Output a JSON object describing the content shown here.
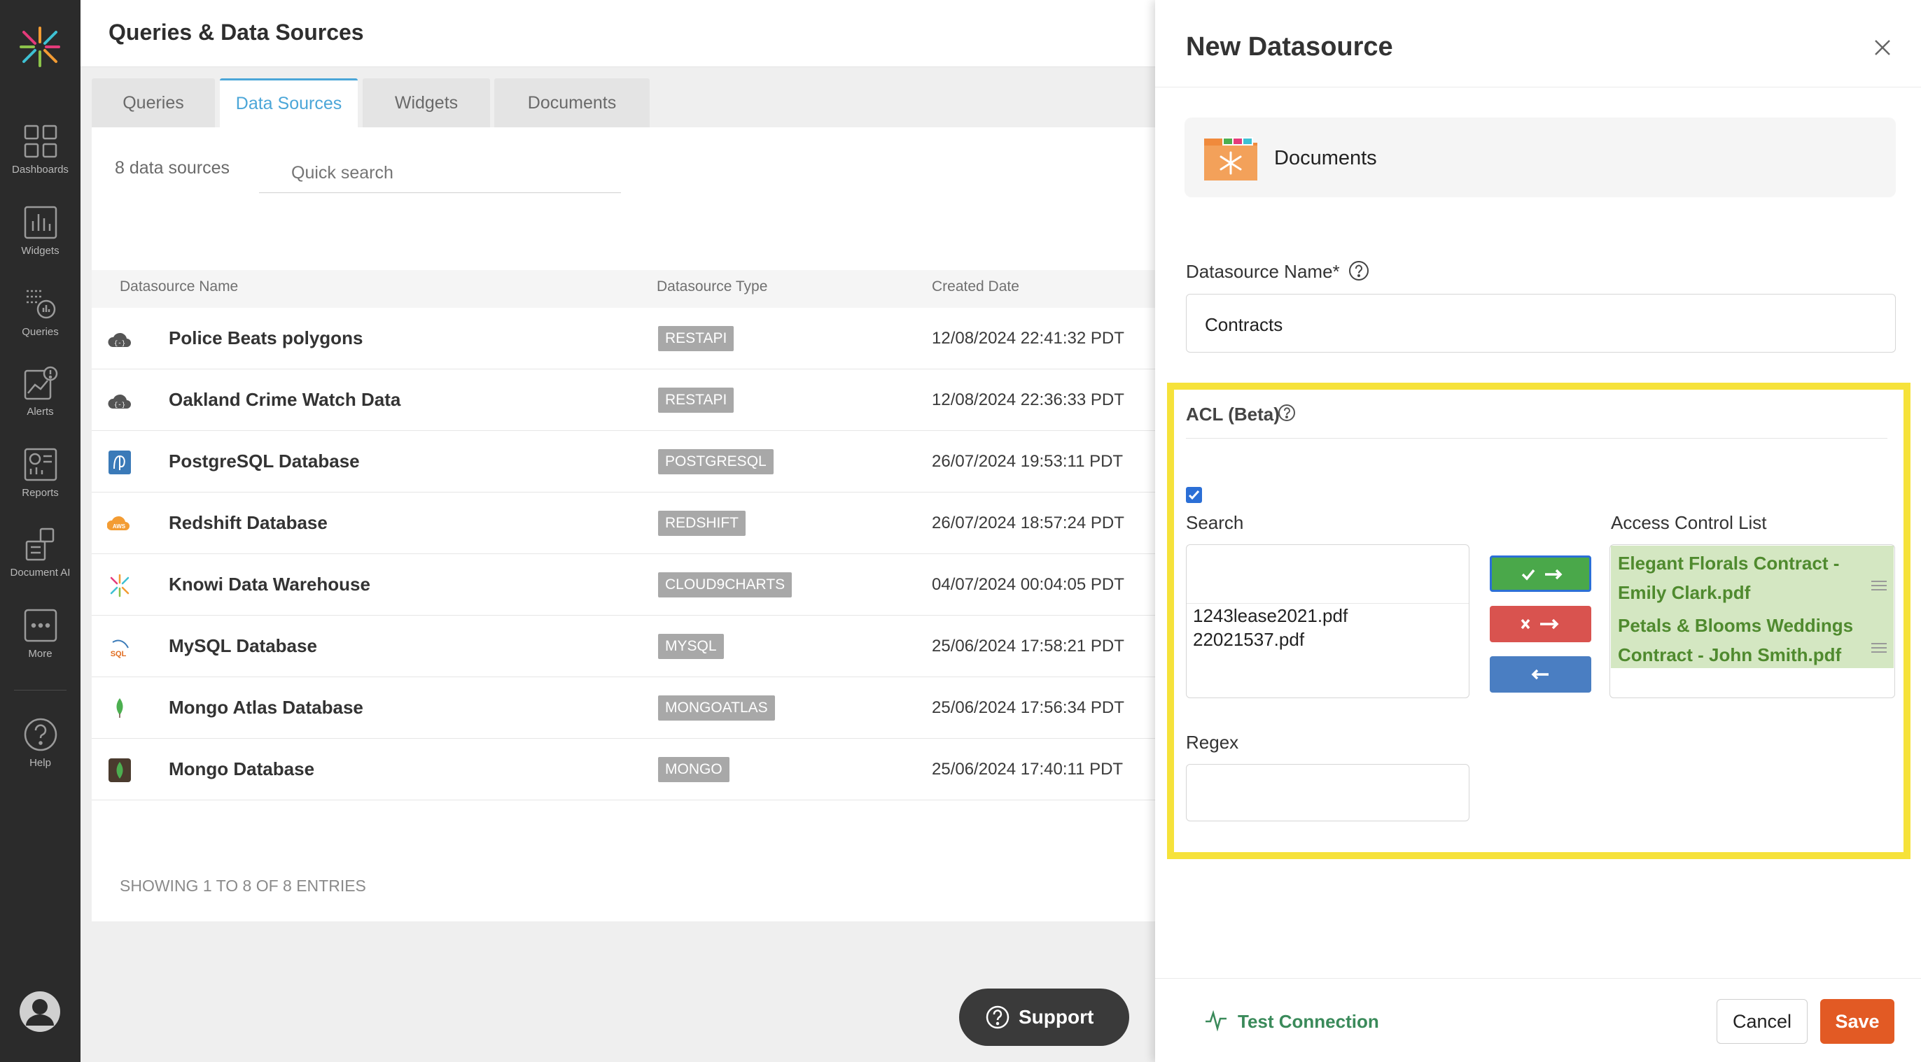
{
  "sidebar": {
    "items": [
      {
        "label": "Dashboards",
        "icon": "dashboards-icon"
      },
      {
        "label": "Widgets",
        "icon": "widgets-icon"
      },
      {
        "label": "Queries",
        "icon": "queries-icon"
      },
      {
        "label": "Alerts",
        "icon": "alerts-icon"
      },
      {
        "label": "Reports",
        "icon": "reports-icon"
      },
      {
        "label": "Document AI",
        "icon": "document-ai-icon"
      },
      {
        "label": "More",
        "icon": "more-icon"
      },
      {
        "label": "Help",
        "icon": "help-icon"
      }
    ]
  },
  "header": {
    "title": "Queries & Data Sources"
  },
  "tabs": [
    {
      "label": "Queries"
    },
    {
      "label": "Data Sources",
      "active": true
    },
    {
      "label": "Widgets"
    },
    {
      "label": "Documents"
    }
  ],
  "list": {
    "count": "8 data sources",
    "search_placeholder": "Quick search",
    "columns": [
      "Datasource Name",
      "Datasource Type",
      "Created Date"
    ],
    "rows": [
      {
        "name": "Police Beats polygons",
        "type": "RESTAPI",
        "date": "12/08/2024 22:41:32 PDT",
        "icon": "cloud-icon"
      },
      {
        "name": "Oakland Crime Watch Data",
        "type": "RESTAPI",
        "date": "12/08/2024 22:36:33 PDT",
        "icon": "cloud-icon"
      },
      {
        "name": "PostgreSQL Database",
        "type": "POSTGRESQL",
        "date": "26/07/2024 19:53:11 PDT",
        "icon": "postgresql-icon"
      },
      {
        "name": "Redshift Database",
        "type": "REDSHIFT",
        "date": "26/07/2024 18:57:24 PDT",
        "icon": "aws-icon"
      },
      {
        "name": "Knowi Data Warehouse",
        "type": "CLOUD9CHARTS",
        "date": "04/07/2024 00:04:05 PDT",
        "icon": "knowi-icon"
      },
      {
        "name": "MySQL Database",
        "type": "MYSQL",
        "date": "25/06/2024 17:58:21 PDT",
        "icon": "mysql-icon"
      },
      {
        "name": "Mongo Atlas Database",
        "type": "MONGOATLAS",
        "date": "25/06/2024 17:56:34 PDT",
        "icon": "mongo-atlas-icon"
      },
      {
        "name": "Mongo Database",
        "type": "MONGO",
        "date": "25/06/2024 17:40:11 PDT",
        "icon": "mongo-icon"
      }
    ],
    "footer": "SHOWING 1 TO 8 OF 8 ENTRIES"
  },
  "support": {
    "label": "Support"
  },
  "drawer": {
    "title": "New Datasource",
    "source_type": "Documents",
    "name_label": "Datasource Name*",
    "name_value": "Contracts",
    "acl": {
      "title": "ACL (Beta)",
      "enabled": true,
      "search_label": "Search",
      "search_items": [
        "1243lease2021.pdf",
        "22021537.pdf"
      ],
      "list_label": "Access Control List",
      "list_items": [
        "Elegant Florals Contract - Emily Clark.pdf",
        "Petals & Blooms Weddings Contract - John Smith.pdf"
      ],
      "regex_label": "Regex"
    },
    "test_connection": "Test Connection",
    "cancel": "Cancel",
    "save": "Save"
  },
  "colors": {
    "accent": "#4ba6d8",
    "highlight": "#f6e23a",
    "save": "#e25a24",
    "add": "#4aa84a",
    "remove": "#d9534f",
    "back": "#4a7ec2",
    "acl_item": "#d4e7c2"
  }
}
